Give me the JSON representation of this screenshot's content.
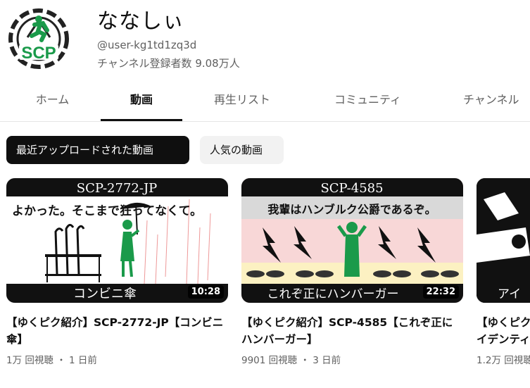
{
  "channel": {
    "name": "ななしぃ",
    "handle": "@user-kg1td1zq3d",
    "subscribers": "チャンネル登録者数 9.08万人",
    "avatar_logo_text": "SCP"
  },
  "tabs": [
    {
      "label": "ホーム"
    },
    {
      "label": "動画"
    },
    {
      "label": "再生リスト"
    },
    {
      "label": "コミュニティ"
    },
    {
      "label": "チャンネル"
    }
  ],
  "active_tab": "動画",
  "chips": [
    {
      "label": "最近アップロードされた動画"
    },
    {
      "label": "人気の動画"
    }
  ],
  "videos": [
    {
      "thumb_header": "SCP-2772-JP",
      "thumb_caption": "よかった。そこまで狂ってなくて。",
      "thumb_footer": "コンビニ傘",
      "duration": "10:28",
      "title": "【ゆくピク紹介】SCP-2772-JP【コンビニ傘】",
      "views": "1万 回視聴",
      "age": "1 日前"
    },
    {
      "thumb_header": "SCP-4585",
      "thumb_caption": "我輩はハンブルク公爵であるぞ。",
      "thumb_footer": "これぞ正にハンバーガー",
      "duration": "22:32",
      "title": "【ゆくピク紹介】SCP-4585【これぞ正にハンバーガー】",
      "views": "9901 回視聴",
      "age": "3 日前"
    },
    {
      "thumb_footer": "アイ",
      "title": "【ゆくピク",
      "title_line2": "イデンティ",
      "views": "1.2万 回視聴"
    }
  ],
  "colors": {
    "scp_green": "#1a9a4a",
    "text_primary": "#0f0f0f",
    "text_secondary": "#606060",
    "chip_active_bg": "#0f0f0f",
    "chip_inactive_bg": "#f2f2f2"
  }
}
